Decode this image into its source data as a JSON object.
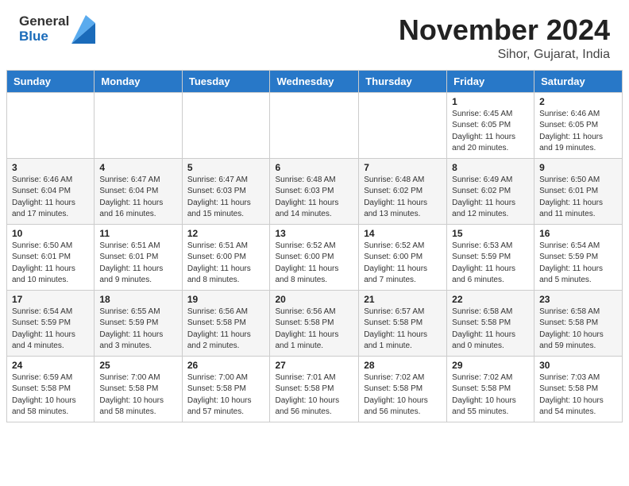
{
  "header": {
    "logo_line1": "General",
    "logo_line2": "Blue",
    "month": "November 2024",
    "location": "Sihor, Gujarat, India"
  },
  "weekdays": [
    "Sunday",
    "Monday",
    "Tuesday",
    "Wednesday",
    "Thursday",
    "Friday",
    "Saturday"
  ],
  "weeks": [
    [
      {
        "day": "",
        "info": ""
      },
      {
        "day": "",
        "info": ""
      },
      {
        "day": "",
        "info": ""
      },
      {
        "day": "",
        "info": ""
      },
      {
        "day": "",
        "info": ""
      },
      {
        "day": "1",
        "info": "Sunrise: 6:45 AM\nSunset: 6:05 PM\nDaylight: 11 hours\nand 20 minutes."
      },
      {
        "day": "2",
        "info": "Sunrise: 6:46 AM\nSunset: 6:05 PM\nDaylight: 11 hours\nand 19 minutes."
      }
    ],
    [
      {
        "day": "3",
        "info": "Sunrise: 6:46 AM\nSunset: 6:04 PM\nDaylight: 11 hours\nand 17 minutes."
      },
      {
        "day": "4",
        "info": "Sunrise: 6:47 AM\nSunset: 6:04 PM\nDaylight: 11 hours\nand 16 minutes."
      },
      {
        "day": "5",
        "info": "Sunrise: 6:47 AM\nSunset: 6:03 PM\nDaylight: 11 hours\nand 15 minutes."
      },
      {
        "day": "6",
        "info": "Sunrise: 6:48 AM\nSunset: 6:03 PM\nDaylight: 11 hours\nand 14 minutes."
      },
      {
        "day": "7",
        "info": "Sunrise: 6:48 AM\nSunset: 6:02 PM\nDaylight: 11 hours\nand 13 minutes."
      },
      {
        "day": "8",
        "info": "Sunrise: 6:49 AM\nSunset: 6:02 PM\nDaylight: 11 hours\nand 12 minutes."
      },
      {
        "day": "9",
        "info": "Sunrise: 6:50 AM\nSunset: 6:01 PM\nDaylight: 11 hours\nand 11 minutes."
      }
    ],
    [
      {
        "day": "10",
        "info": "Sunrise: 6:50 AM\nSunset: 6:01 PM\nDaylight: 11 hours\nand 10 minutes."
      },
      {
        "day": "11",
        "info": "Sunrise: 6:51 AM\nSunset: 6:01 PM\nDaylight: 11 hours\nand 9 minutes."
      },
      {
        "day": "12",
        "info": "Sunrise: 6:51 AM\nSunset: 6:00 PM\nDaylight: 11 hours\nand 8 minutes."
      },
      {
        "day": "13",
        "info": "Sunrise: 6:52 AM\nSunset: 6:00 PM\nDaylight: 11 hours\nand 8 minutes."
      },
      {
        "day": "14",
        "info": "Sunrise: 6:52 AM\nSunset: 6:00 PM\nDaylight: 11 hours\nand 7 minutes."
      },
      {
        "day": "15",
        "info": "Sunrise: 6:53 AM\nSunset: 5:59 PM\nDaylight: 11 hours\nand 6 minutes."
      },
      {
        "day": "16",
        "info": "Sunrise: 6:54 AM\nSunset: 5:59 PM\nDaylight: 11 hours\nand 5 minutes."
      }
    ],
    [
      {
        "day": "17",
        "info": "Sunrise: 6:54 AM\nSunset: 5:59 PM\nDaylight: 11 hours\nand 4 minutes."
      },
      {
        "day": "18",
        "info": "Sunrise: 6:55 AM\nSunset: 5:59 PM\nDaylight: 11 hours\nand 3 minutes."
      },
      {
        "day": "19",
        "info": "Sunrise: 6:56 AM\nSunset: 5:58 PM\nDaylight: 11 hours\nand 2 minutes."
      },
      {
        "day": "20",
        "info": "Sunrise: 6:56 AM\nSunset: 5:58 PM\nDaylight: 11 hours\nand 1 minute."
      },
      {
        "day": "21",
        "info": "Sunrise: 6:57 AM\nSunset: 5:58 PM\nDaylight: 11 hours\nand 1 minute."
      },
      {
        "day": "22",
        "info": "Sunrise: 6:58 AM\nSunset: 5:58 PM\nDaylight: 11 hours\nand 0 minutes."
      },
      {
        "day": "23",
        "info": "Sunrise: 6:58 AM\nSunset: 5:58 PM\nDaylight: 10 hours\nand 59 minutes."
      }
    ],
    [
      {
        "day": "24",
        "info": "Sunrise: 6:59 AM\nSunset: 5:58 PM\nDaylight: 10 hours\nand 58 minutes."
      },
      {
        "day": "25",
        "info": "Sunrise: 7:00 AM\nSunset: 5:58 PM\nDaylight: 10 hours\nand 58 minutes."
      },
      {
        "day": "26",
        "info": "Sunrise: 7:00 AM\nSunset: 5:58 PM\nDaylight: 10 hours\nand 57 minutes."
      },
      {
        "day": "27",
        "info": "Sunrise: 7:01 AM\nSunset: 5:58 PM\nDaylight: 10 hours\nand 56 minutes."
      },
      {
        "day": "28",
        "info": "Sunrise: 7:02 AM\nSunset: 5:58 PM\nDaylight: 10 hours\nand 56 minutes."
      },
      {
        "day": "29",
        "info": "Sunrise: 7:02 AM\nSunset: 5:58 PM\nDaylight: 10 hours\nand 55 minutes."
      },
      {
        "day": "30",
        "info": "Sunrise: 7:03 AM\nSunset: 5:58 PM\nDaylight: 10 hours\nand 54 minutes."
      }
    ]
  ]
}
